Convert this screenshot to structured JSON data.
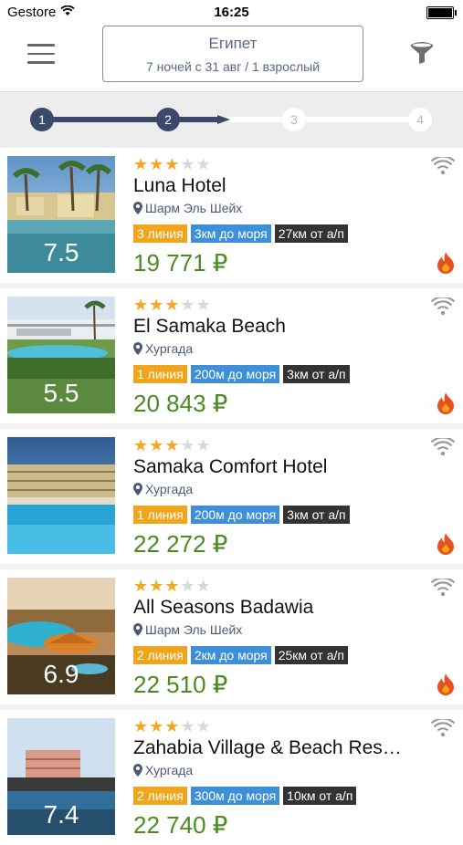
{
  "status_bar": {
    "carrier": "Gestore",
    "time": "16:25"
  },
  "header": {
    "search_title": "Египет",
    "search_subtitle": "7 ночей с 31 авг / 1 взрослый"
  },
  "steps": [
    {
      "label": "1",
      "active": true
    },
    {
      "label": "2",
      "active": true
    },
    {
      "label": "3",
      "active": false
    },
    {
      "label": "4",
      "active": false
    }
  ],
  "hotels": [
    {
      "stars": 3,
      "name": "Luna Hotel",
      "location": "Шарм Эль Шейх",
      "line": "3 линия",
      "sea": "3км до моря",
      "airport": "27км от а/п",
      "price": "19 771 ₽",
      "rating": "7.5",
      "hot": true
    },
    {
      "stars": 3,
      "name": "El Samaka Beach",
      "location": "Хургада",
      "line": "1 линия",
      "sea": "200м до моря",
      "airport": "3км от а/п",
      "price": "20 843 ₽",
      "rating": "5.5",
      "hot": true
    },
    {
      "stars": 3,
      "name": "Samaka Comfort Hotel",
      "location": "Хургада",
      "line": "1 линия",
      "sea": "200м до моря",
      "airport": "3км от а/п",
      "price": "22 272 ₽",
      "rating": "",
      "hot": true
    },
    {
      "stars": 3,
      "name": "All Seasons Badawia",
      "location": "Шарм Эль Шейх",
      "line": "2 линия",
      "sea": "2км до моря",
      "airport": "25км от а/п",
      "price": "22 510 ₽",
      "rating": "6.9",
      "hot": true
    },
    {
      "stars": 3,
      "name": "Zahabia Village & Beach Res…",
      "location": "Хургада",
      "line": "2 линия",
      "sea": "300м до моря",
      "airport": "10км от а/п",
      "price": "22 740 ₽",
      "rating": "7.4",
      "hot": false
    }
  ]
}
